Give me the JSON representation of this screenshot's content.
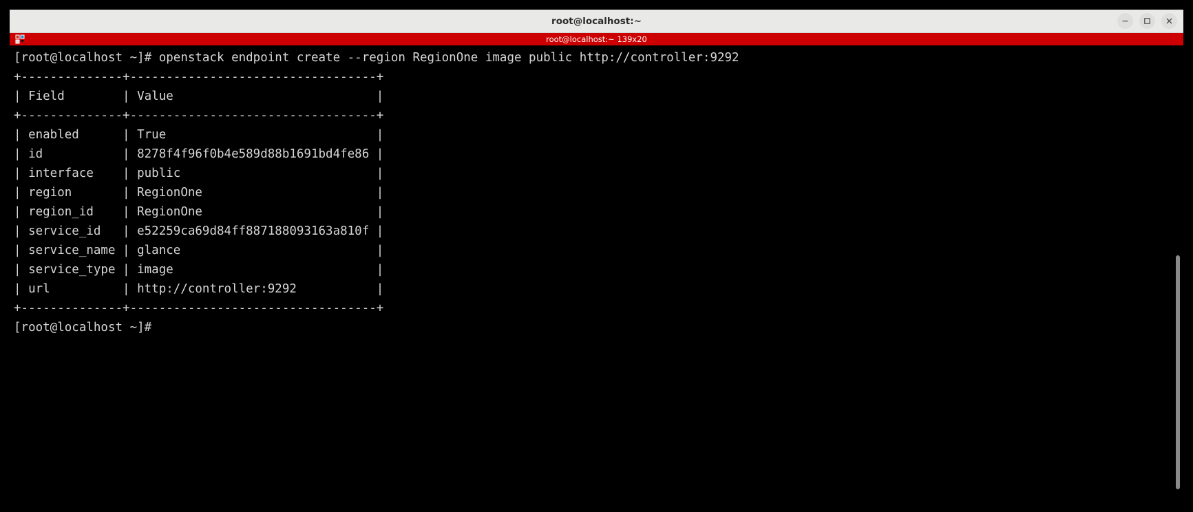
{
  "window": {
    "title": "root@localhost:~",
    "controls": {
      "minimize_label": "Minimize",
      "maximize_label": "Maximize",
      "close_label": "Close"
    }
  },
  "tabbar": {
    "icon": "terminal-tab-icon",
    "tab_label": "root@localhost:~ 139x20"
  },
  "theme": {
    "titlebar_bg": "#e9e9e8",
    "tabbar_bg": "#cc0000",
    "terminal_bg": "#000000",
    "terminal_fg": "#d6d6d6",
    "scrollbar": "#8a8a8a"
  },
  "terminal": {
    "columns": 139,
    "rows": 20,
    "prompt": "[root@localhost ~]#",
    "command": "openstack endpoint create --region RegionOne image public http://controller:9292",
    "lines": [
      "[root@localhost ~]# openstack endpoint create --region RegionOne image public http://controller:9292",
      "+--------------+----------------------------------+",
      "| Field        | Value                            |",
      "+--------------+----------------------------------+",
      "| enabled      | True                             |",
      "| id           | 8278f4f96f0b4e589d88b1691bd4fe86 |",
      "| interface    | public                           |",
      "| region       | RegionOne                        |",
      "| region_id    | RegionOne                        |",
      "| service_id   | e52259ca69d84ff887188093163a810f |",
      "| service_name | glance                           |",
      "| service_type | image                            |",
      "| url          | http://controller:9292           |",
      "+--------------+----------------------------------+",
      "[root@localhost ~]#"
    ],
    "table": {
      "headers": [
        "Field",
        "Value"
      ],
      "rows": [
        [
          "enabled",
          "True"
        ],
        [
          "id",
          "8278f4f96f0b4e589d88b1691bd4fe86"
        ],
        [
          "interface",
          "public"
        ],
        [
          "region",
          "RegionOne"
        ],
        [
          "region_id",
          "RegionOne"
        ],
        [
          "service_id",
          "e52259ca69d84ff887188093163a810f"
        ],
        [
          "service_name",
          "glance"
        ],
        [
          "service_type",
          "image"
        ],
        [
          "url",
          "http://controller:9292"
        ]
      ]
    }
  }
}
